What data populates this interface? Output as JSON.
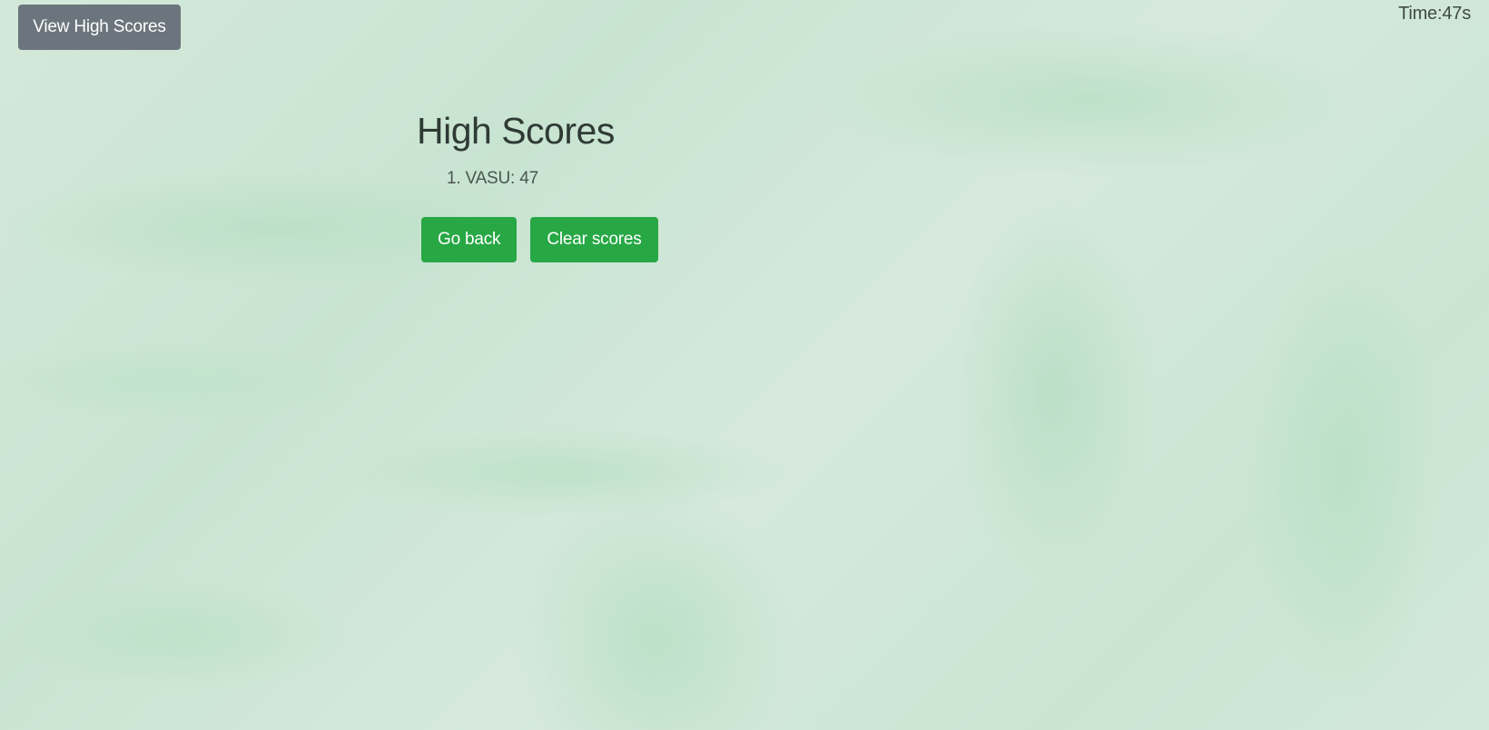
{
  "header": {
    "view_high_scores_label": "View High Scores",
    "timer_label": "Time:",
    "timer_value": "47s"
  },
  "main": {
    "title": "High Scores",
    "scores": [
      {
        "text": "1. VASU: 47"
      }
    ],
    "go_back_label": "Go back",
    "clear_scores_label": "Clear scores"
  },
  "colors": {
    "secondary_button": "#6c757d",
    "success_button": "#28a745",
    "background": "#cfe6d5"
  }
}
